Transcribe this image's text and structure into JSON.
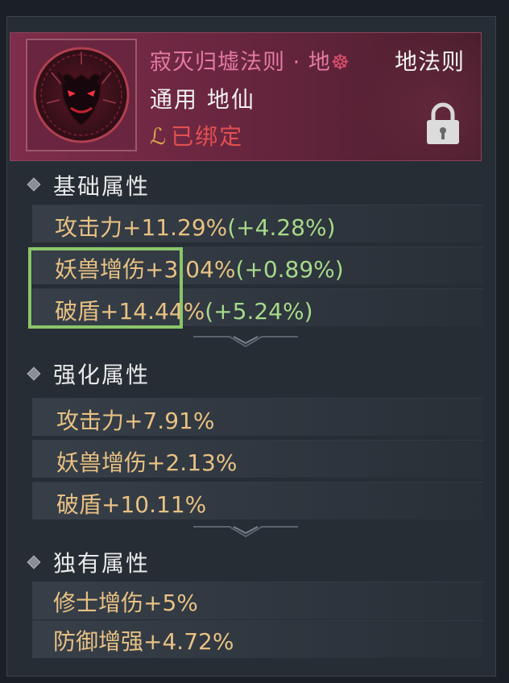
{
  "item": {
    "name": "寂灭归墟法则 · 地",
    "seal_icon": "dharma-seal-icon",
    "type": "地法则",
    "class": "通用 地仙",
    "bind_status": "已绑定",
    "lock_icon": "padlock-icon"
  },
  "sections": {
    "basic": {
      "title": "基础属性",
      "stats": [
        {
          "name": "攻击力",
          "value": "+11.29%",
          "bonus": "(+4.28%)"
        },
        {
          "name": "妖兽增伤",
          "value": "+3.04%",
          "bonus": "(+0.89%)"
        },
        {
          "name": "破盾",
          "value": "+14.44%",
          "bonus": "(+5.24%)"
        }
      ]
    },
    "enhanced": {
      "title": "强化属性",
      "stats": [
        {
          "name": "攻击力",
          "value": "+7.91%"
        },
        {
          "name": "妖兽增伤",
          "value": "+2.13%"
        },
        {
          "name": "破盾",
          "value": "+10.11%"
        }
      ]
    },
    "unique": {
      "title": "独有属性",
      "stats": [
        {
          "name": "修士增伤",
          "value": "+5%"
        },
        {
          "name": "防御增强",
          "value": "+4.72%"
        }
      ]
    }
  },
  "colors": {
    "header_bg": "#6a2640",
    "item_name": "#e47aa3",
    "stat_text": "#e8c183",
    "bonus_text": "#a7d98a",
    "bind_text": "#e25050",
    "highlight_box": "#8bc66a"
  }
}
